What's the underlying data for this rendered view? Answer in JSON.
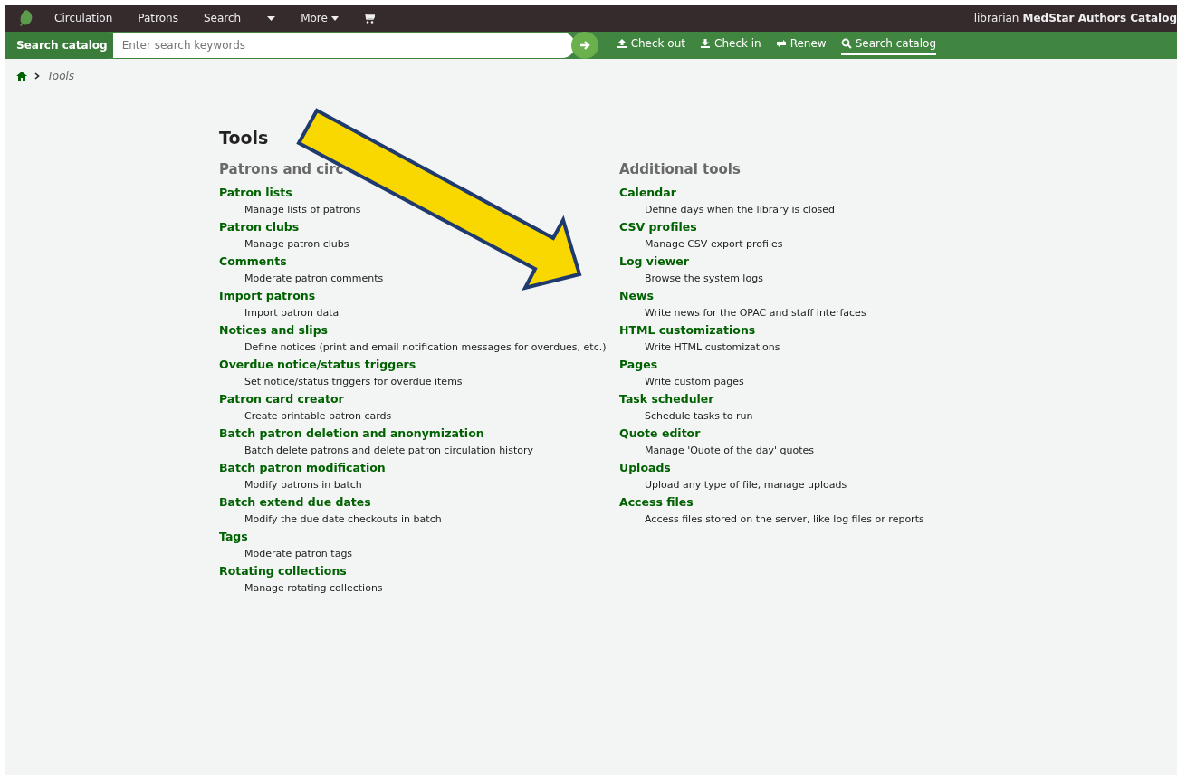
{
  "navbar": {
    "items": [
      {
        "label": "Circulation",
        "kind": "link"
      },
      {
        "label": "Patrons",
        "kind": "link"
      },
      {
        "label": "Search",
        "kind": "link"
      },
      {
        "kind": "caret"
      },
      {
        "label": "More",
        "kind": "dropdown"
      },
      {
        "kind": "cart"
      }
    ],
    "user": "librarian",
    "library": "MedStar Authors Catalog"
  },
  "search": {
    "label": "Search catalog",
    "placeholder": "Enter search keywords"
  },
  "toolbar": [
    {
      "label": "Check out",
      "kind": "upload",
      "selected": false
    },
    {
      "label": "Check in",
      "kind": "download",
      "selected": false
    },
    {
      "label": "Renew",
      "kind": "renew",
      "selected": false
    },
    {
      "label": "Search catalog",
      "kind": "search",
      "selected": true
    }
  ],
  "breadcrumb": [
    "Tools"
  ],
  "title": "Tools",
  "columns": [
    {
      "heading": "Patrons and circ",
      "tools": [
        {
          "name": "Patron lists",
          "description": "Manage lists of patrons"
        },
        {
          "name": "Patron clubs",
          "description": "Manage patron clubs"
        },
        {
          "name": "Comments",
          "description": "Moderate patron comments"
        },
        {
          "name": "Import patrons",
          "description": "Import patron data"
        },
        {
          "name": "Notices and slips",
          "description": "Define notices (print and email notification messages for overdues, etc.)"
        },
        {
          "name": "Overdue notice/status triggers",
          "description": "Set notice/status triggers for overdue items"
        },
        {
          "name": "Patron card creator",
          "description": "Create printable patron cards"
        },
        {
          "name": "Batch patron deletion and anonymization",
          "description": "Batch delete patrons and delete patron circulation history"
        },
        {
          "name": "Batch patron modification",
          "description": "Modify patrons in batch"
        },
        {
          "name": "Batch extend due dates",
          "description": "Modify the due date checkouts in batch"
        },
        {
          "name": "Tags",
          "description": "Moderate patron tags"
        },
        {
          "name": "Rotating collections",
          "description": "Manage rotating collections"
        }
      ]
    },
    {
      "heading": "Additional tools",
      "tools": [
        {
          "name": "Calendar",
          "description": "Define days when the library is closed"
        },
        {
          "name": "CSV profiles",
          "description": "Manage CSV export profiles"
        },
        {
          "name": "Log viewer",
          "description": "Browse the system logs"
        },
        {
          "name": "News",
          "description": "Write news for the OPAC and staff interfaces"
        },
        {
          "name": "HTML customizations",
          "description": "Write HTML customizations"
        },
        {
          "name": "Pages",
          "description": "Write custom pages"
        },
        {
          "name": "Task scheduler",
          "description": "Schedule tasks to run"
        },
        {
          "name": "Quote editor",
          "description": "Manage 'Quote of the day' quotes"
        },
        {
          "name": "Uploads",
          "description": "Upload any type of file, manage uploads"
        },
        {
          "name": "Access files",
          "description": "Access files stored on the server, like log files or reports"
        }
      ]
    }
  ]
}
